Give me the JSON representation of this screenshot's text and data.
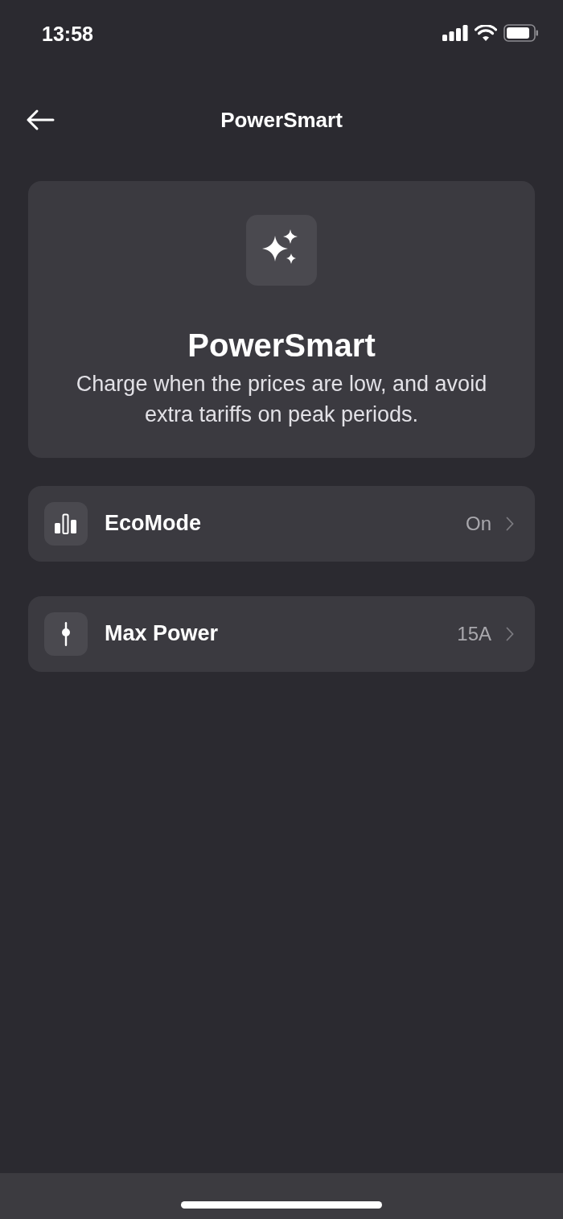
{
  "status_bar": {
    "time": "13:58"
  },
  "header": {
    "title": "PowerSmart"
  },
  "hero": {
    "title": "PowerSmart",
    "description": "Charge when the prices are low, and avoid extra tariffs on peak periods."
  },
  "settings": [
    {
      "kind": "bars",
      "label": "EcoMode",
      "value": "On"
    },
    {
      "kind": "slider",
      "label": "Max Power",
      "value": "15A"
    }
  ]
}
